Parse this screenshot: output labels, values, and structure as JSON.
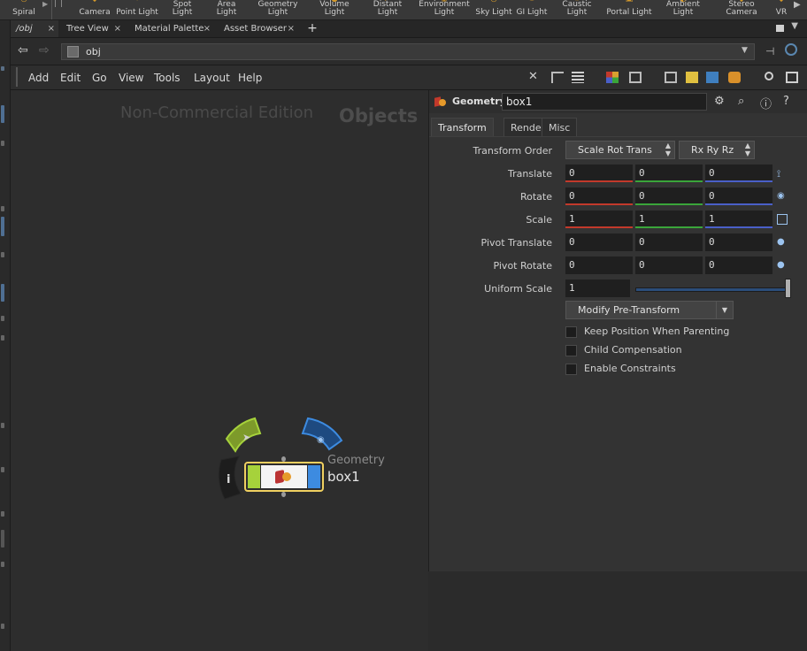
{
  "shelf": {
    "tools": [
      {
        "label": "Spiral",
        "icon": "spiral-icon"
      },
      {
        "label": "Camera",
        "icon": "camera-icon"
      },
      {
        "label": "Point Light",
        "icon": "point-light-icon"
      },
      {
        "label": "Spot Light",
        "icon": "spot-light-icon"
      },
      {
        "label": "Area Light",
        "icon": "area-light-icon"
      },
      {
        "label": "Geometry\nLight",
        "icon": "geometry-light-icon"
      },
      {
        "label": "Volume Light",
        "icon": "volume-light-icon"
      },
      {
        "label": "Distant Light",
        "icon": "distant-light-icon"
      },
      {
        "label": "Environment\nLight",
        "icon": "environment-light-icon"
      },
      {
        "label": "Sky Light",
        "icon": "sky-light-icon"
      },
      {
        "label": "GI Light",
        "icon": "gi-light-icon"
      },
      {
        "label": "Caustic Light",
        "icon": "caustic-light-icon"
      },
      {
        "label": "Portal Light",
        "icon": "portal-light-icon"
      },
      {
        "label": "Ambient Light",
        "icon": "ambient-light-icon"
      },
      {
        "label": "Stereo\nCamera",
        "icon": "stereo-camera-icon"
      },
      {
        "label": "VR",
        "icon": "vr-camera-icon"
      }
    ]
  },
  "tabs": [
    {
      "label": "/obj",
      "close": "×"
    },
    {
      "label": "Tree View",
      "close": "×"
    },
    {
      "label": "Material Palette",
      "close": "×"
    },
    {
      "label": "Asset Browser",
      "close": "×"
    }
  ],
  "tab_add": "+",
  "path": {
    "value": "obj"
  },
  "menu": [
    "Add",
    "Edit",
    "Go",
    "View",
    "Tools",
    "Layout",
    "Help"
  ],
  "network": {
    "watermark": "Non-Commercial Edition",
    "context": "Objects",
    "node": {
      "type": "Geometry",
      "name": "box1",
      "info": "i"
    }
  },
  "params": {
    "node_type": "Geometry",
    "node_name": "box1",
    "tabs": [
      "Transform",
      "Render",
      "Misc"
    ],
    "transform_order": {
      "label": "Transform Order",
      "order": "Scale Rot Trans",
      "rot_order": "Rx Ry Rz"
    },
    "translate": {
      "label": "Translate",
      "values": [
        "0",
        "0",
        "0"
      ]
    },
    "rotate": {
      "label": "Rotate",
      "values": [
        "0",
        "0",
        "0"
      ]
    },
    "scale": {
      "label": "Scale",
      "values": [
        "1",
        "1",
        "1"
      ]
    },
    "pivot_translate": {
      "label": "Pivot Translate",
      "values": [
        "0",
        "0",
        "0"
      ]
    },
    "pivot_rotate": {
      "label": "Pivot Rotate",
      "values": [
        "0",
        "0",
        "0"
      ]
    },
    "uniform_scale": {
      "label": "Uniform Scale",
      "value": "1",
      "slider_fraction": 1.0
    },
    "modify_menu": "Modify Pre-Transform",
    "checkboxes": [
      {
        "label": "Keep Position When Parenting",
        "checked": false
      },
      {
        "label": "Child Compensation",
        "checked": false
      },
      {
        "label": "Enable Constraints",
        "checked": false
      }
    ]
  },
  "colors": {
    "accent_blue": "#4a5fc8",
    "x_red": "#c2392b",
    "y_green": "#3aa53a",
    "node_green": "#a6d23b",
    "node_blue": "#3d8be0",
    "node_outline": "#f0d060"
  }
}
